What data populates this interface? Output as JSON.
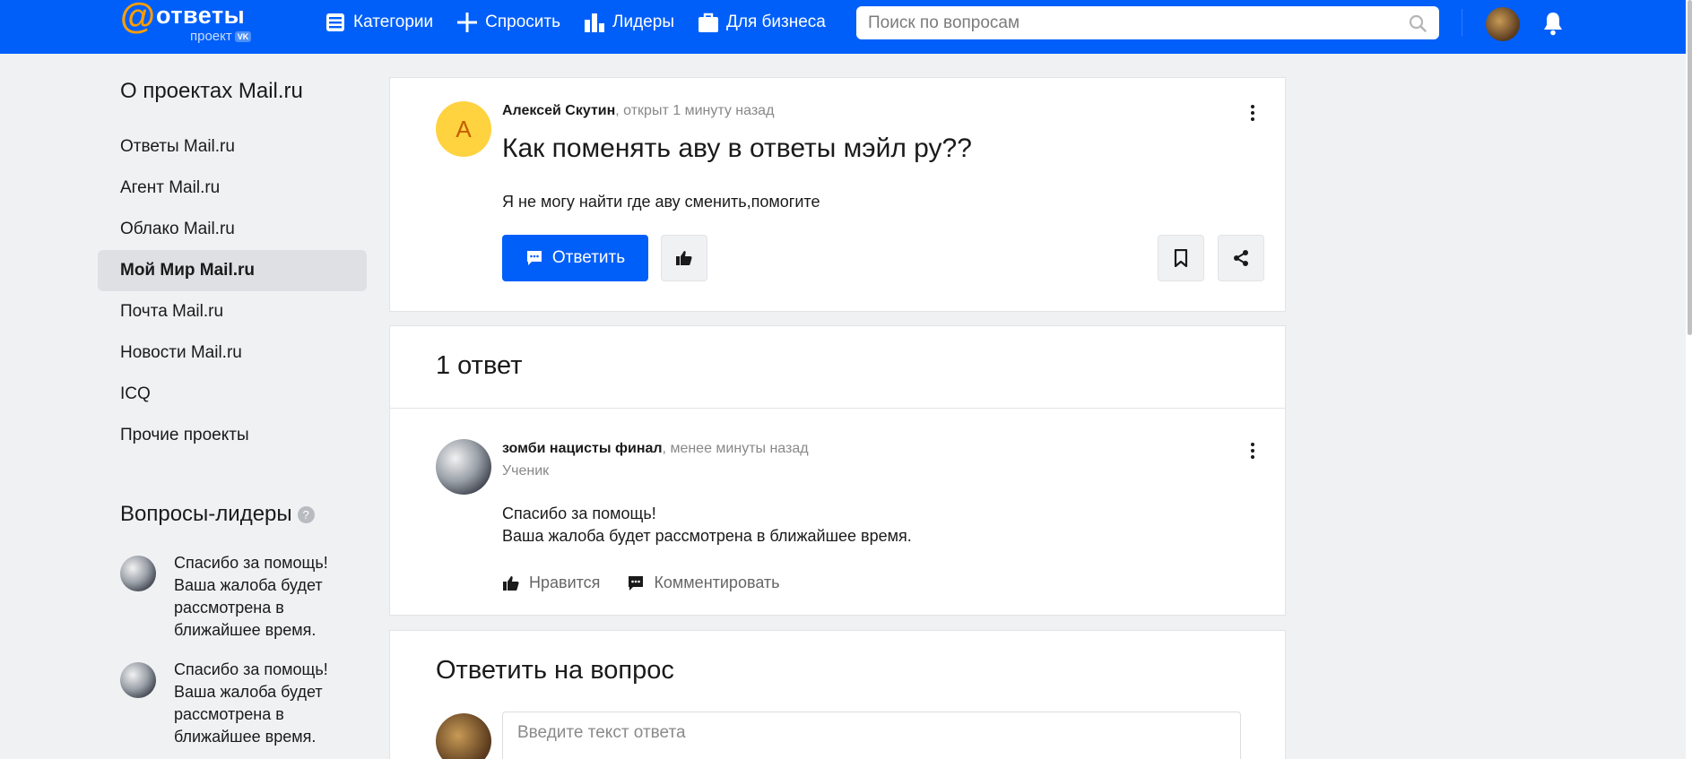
{
  "header": {
    "logo_text": "ответы",
    "logo_sub": "проект",
    "logo_badge": "VK",
    "nav": [
      {
        "label": "Категории",
        "icon": "list-icon"
      },
      {
        "label": "Спросить",
        "icon": "plus-icon"
      },
      {
        "label": "Лидеры",
        "icon": "bar-chart-icon"
      },
      {
        "label": "Для бизнеса",
        "icon": "briefcase-icon"
      }
    ],
    "search_placeholder": "Поиск по вопросам"
  },
  "sidebar": {
    "title": "О проектах Mail.ru",
    "items": [
      {
        "label": "Ответы Mail.ru",
        "active": false
      },
      {
        "label": "Агент Mail.ru",
        "active": false
      },
      {
        "label": "Облако Mail.ru",
        "active": false
      },
      {
        "label": "Мой Мир Mail.ru",
        "active": true
      },
      {
        "label": "Почта Mail.ru",
        "active": false
      },
      {
        "label": "Новости Mail.ru",
        "active": false
      },
      {
        "label": "ICQ",
        "active": false
      },
      {
        "label": "Прочие проекты",
        "active": false
      }
    ],
    "leaders_title": "Вопросы-лидеры",
    "leaders_help": "?",
    "leaders": [
      {
        "text": "Спасибо за помощь! Ваша жалоба будет рассмотрена в ближайшее время."
      },
      {
        "text": "Спасибо за помощь! Ваша жалоба будет рассмотрена в ближайшее время."
      }
    ]
  },
  "question": {
    "avatar_letter": "А",
    "author": "Алексей Скутин",
    "meta": ", открыт 1 минуту назад",
    "title": "Как поменять аву в ответы мэйл ру??",
    "body": "Я не могу найти где аву сменить,помогите",
    "answer_button": "Ответить"
  },
  "answers": {
    "count_label": "1 ответ",
    "items": [
      {
        "author": "зомби нацисты финал",
        "meta": ", менее минуты назад",
        "rank": "Ученик",
        "body_line1": "Спасибо за помощь!",
        "body_line2": "Ваша жалоба будет рассмотрена в ближайшее время.",
        "like_label": "Нравится",
        "comment_label": "Комментировать"
      }
    ]
  },
  "reply": {
    "title": "Ответить на вопрос",
    "placeholder": "Введите текст ответа"
  },
  "colors": {
    "brand": "#005ff9",
    "logo_accent": "#ff9e00",
    "avatar_yellow": "#ffd23f"
  }
}
